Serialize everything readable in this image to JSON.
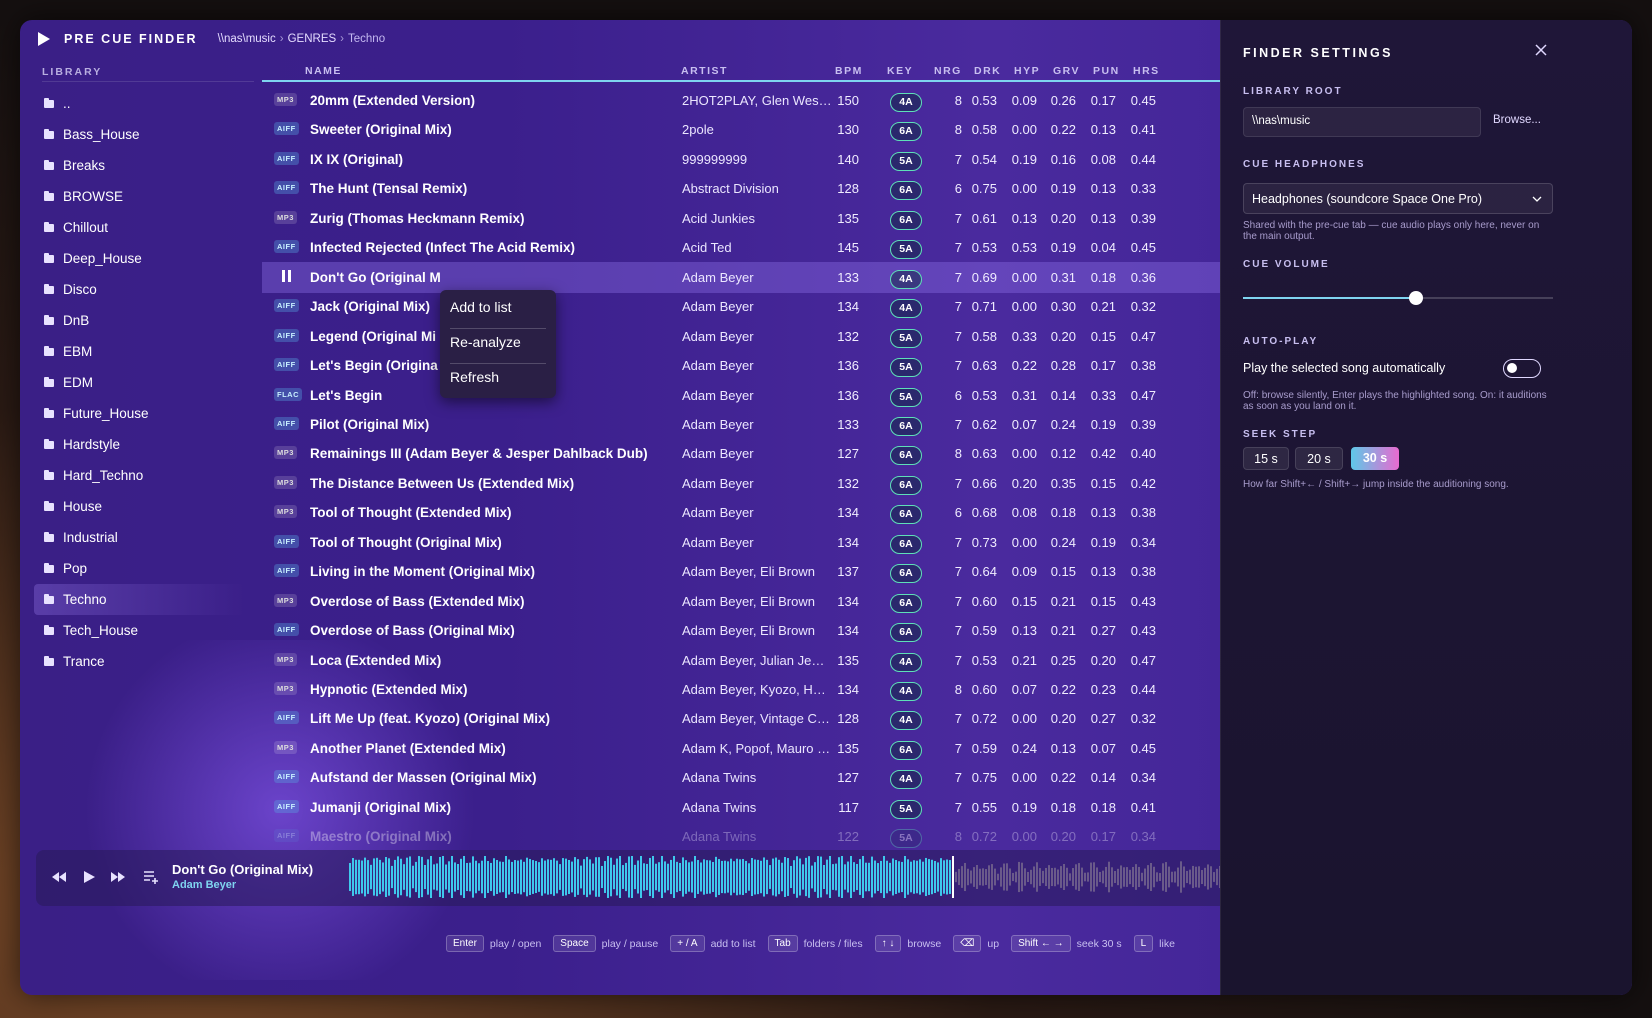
{
  "app": {
    "title": "PRE CUE FINDER"
  },
  "breadcrumb": [
    "\\\\nas\\music",
    "GENRES",
    "Techno"
  ],
  "library": {
    "heading": "LIBRARY",
    "folders": [
      "..",
      "Bass_House",
      "Breaks",
      "BROWSE",
      "Chillout",
      "Deep_House",
      "Disco",
      "DnB",
      "EBM",
      "EDM",
      "Future_House",
      "Hardstyle",
      "Hard_Techno",
      "House",
      "Industrial",
      "Pop",
      "Techno",
      "Tech_House",
      "Trance"
    ],
    "active": "Techno"
  },
  "columns": {
    "name": "NAME",
    "artist": "ARTIST",
    "bpm": "BPM",
    "key": "KEY",
    "nrg": "NRG",
    "drk": "DRK",
    "hyp": "HYP",
    "grv": "GRV",
    "pun": "PUN",
    "hrs": "HRS"
  },
  "tracks": [
    {
      "fmt": "MP3",
      "name": "20mm (Extended Version)",
      "artist": "2HOT2PLAY, Glen West ...",
      "bpm": "150",
      "key": "4A",
      "nrg": "8",
      "drk": "0.53",
      "hyp": "0.09",
      "grv": "0.26",
      "pun": "0.17",
      "hrs": "0.45"
    },
    {
      "fmt": "AIFF",
      "name": "Sweeter (Original Mix)",
      "artist": "2pole",
      "bpm": "130",
      "key": "6A",
      "nrg": "8",
      "drk": "0.58",
      "hyp": "0.00",
      "grv": "0.22",
      "pun": "0.13",
      "hrs": "0.41"
    },
    {
      "fmt": "AIFF",
      "name": "IX IX (Original)",
      "artist": "999999999",
      "bpm": "140",
      "key": "5A",
      "nrg": "7",
      "drk": "0.54",
      "hyp": "0.19",
      "grv": "0.16",
      "pun": "0.08",
      "hrs": "0.44"
    },
    {
      "fmt": "AIFF",
      "name": "The Hunt (Tensal Remix)",
      "artist": "Abstract Division",
      "bpm": "128",
      "key": "6A",
      "nrg": "6",
      "drk": "0.75",
      "hyp": "0.00",
      "grv": "0.19",
      "pun": "0.13",
      "hrs": "0.33"
    },
    {
      "fmt": "MP3",
      "name": "Zurig (Thomas Heckmann Remix)",
      "artist": "Acid Junkies",
      "bpm": "135",
      "key": "6A",
      "nrg": "7",
      "drk": "0.61",
      "hyp": "0.13",
      "grv": "0.20",
      "pun": "0.13",
      "hrs": "0.39"
    },
    {
      "fmt": "AIFF",
      "name": "Infected Rejected (Infect The Acid Remix)",
      "artist": "Acid Ted",
      "bpm": "145",
      "key": "5A",
      "nrg": "7",
      "drk": "0.53",
      "hyp": "0.53",
      "grv": "0.19",
      "pun": "0.04",
      "hrs": "0.45"
    },
    {
      "fmt": "",
      "name": "Don't Go (Original M",
      "artist": "Adam Beyer",
      "bpm": "133",
      "key": "4A",
      "nrg": "7",
      "drk": "0.69",
      "hyp": "0.00",
      "grv": "0.31",
      "pun": "0.18",
      "hrs": "0.36",
      "playing": true
    },
    {
      "fmt": "AIFF",
      "name": "Jack (Original Mix)",
      "artist": "Adam Beyer",
      "bpm": "134",
      "key": "4A",
      "nrg": "7",
      "drk": "0.71",
      "hyp": "0.00",
      "grv": "0.30",
      "pun": "0.21",
      "hrs": "0.32"
    },
    {
      "fmt": "AIFF",
      "name": "Legend (Original Mi",
      "artist": "Adam Beyer",
      "bpm": "132",
      "key": "5A",
      "nrg": "7",
      "drk": "0.58",
      "hyp": "0.33",
      "grv": "0.20",
      "pun": "0.15",
      "hrs": "0.47"
    },
    {
      "fmt": "AIFF",
      "name": "Let's Begin (Origina",
      "artist": "Adam Beyer",
      "bpm": "136",
      "key": "5A",
      "nrg": "7",
      "drk": "0.63",
      "hyp": "0.22",
      "grv": "0.28",
      "pun": "0.17",
      "hrs": "0.38"
    },
    {
      "fmt": "FLAC",
      "name": "Let's Begin",
      "artist": "Adam Beyer",
      "bpm": "136",
      "key": "5A",
      "nrg": "6",
      "drk": "0.53",
      "hyp": "0.31",
      "grv": "0.14",
      "pun": "0.33",
      "hrs": "0.47"
    },
    {
      "fmt": "AIFF",
      "name": "Pilot (Original Mix)",
      "artist": "Adam Beyer",
      "bpm": "133",
      "key": "6A",
      "nrg": "7",
      "drk": "0.62",
      "hyp": "0.07",
      "grv": "0.24",
      "pun": "0.19",
      "hrs": "0.39"
    },
    {
      "fmt": "MP3",
      "name": "Remainings III (Adam Beyer & Jesper Dahlback Dub)",
      "artist": "Adam Beyer",
      "bpm": "127",
      "key": "6A",
      "nrg": "8",
      "drk": "0.63",
      "hyp": "0.00",
      "grv": "0.12",
      "pun": "0.42",
      "hrs": "0.40"
    },
    {
      "fmt": "MP3",
      "name": "The Distance Between Us (Extended Mix)",
      "artist": "Adam Beyer",
      "bpm": "132",
      "key": "6A",
      "nrg": "7",
      "drk": "0.66",
      "hyp": "0.20",
      "grv": "0.35",
      "pun": "0.15",
      "hrs": "0.42"
    },
    {
      "fmt": "MP3",
      "name": "Tool of Thought (Extended Mix)",
      "artist": "Adam Beyer",
      "bpm": "134",
      "key": "6A",
      "nrg": "6",
      "drk": "0.68",
      "hyp": "0.08",
      "grv": "0.18",
      "pun": "0.13",
      "hrs": "0.38"
    },
    {
      "fmt": "AIFF",
      "name": "Tool of Thought (Original Mix)",
      "artist": "Adam Beyer",
      "bpm": "134",
      "key": "6A",
      "nrg": "7",
      "drk": "0.73",
      "hyp": "0.00",
      "grv": "0.24",
      "pun": "0.19",
      "hrs": "0.34"
    },
    {
      "fmt": "AIFF",
      "name": "Living in the Moment (Original Mix)",
      "artist": "Adam Beyer, Eli Brown",
      "bpm": "137",
      "key": "6A",
      "nrg": "7",
      "drk": "0.64",
      "hyp": "0.09",
      "grv": "0.15",
      "pun": "0.13",
      "hrs": "0.38"
    },
    {
      "fmt": "MP3",
      "name": "Overdose of Bass (Extended Mix)",
      "artist": "Adam Beyer, Eli Brown",
      "bpm": "134",
      "key": "6A",
      "nrg": "7",
      "drk": "0.60",
      "hyp": "0.15",
      "grv": "0.21",
      "pun": "0.15",
      "hrs": "0.43"
    },
    {
      "fmt": "AIFF",
      "name": "Overdose of Bass (Original Mix)",
      "artist": "Adam Beyer, Eli Brown",
      "bpm": "134",
      "key": "6A",
      "nrg": "7",
      "drk": "0.59",
      "hyp": "0.13",
      "grv": "0.21",
      "pun": "0.27",
      "hrs": "0.43"
    },
    {
      "fmt": "MP3",
      "name": "Loca (Extended Mix)",
      "artist": "Adam Beyer, Julian Jeweil",
      "bpm": "135",
      "key": "4A",
      "nrg": "7",
      "drk": "0.53",
      "hyp": "0.21",
      "grv": "0.25",
      "pun": "0.20",
      "hrs": "0.47"
    },
    {
      "fmt": "MP3",
      "name": "Hypnotic (Extended Mix)",
      "artist": "Adam Beyer, Kyozo, HNTR",
      "bpm": "134",
      "key": "4A",
      "nrg": "8",
      "drk": "0.60",
      "hyp": "0.07",
      "grv": "0.22",
      "pun": "0.23",
      "hrs": "0.44"
    },
    {
      "fmt": "AIFF",
      "name": "Lift Me Up (feat. Kyozo) (Original Mix)",
      "artist": "Adam Beyer, Vintage Cul...",
      "bpm": "128",
      "key": "4A",
      "nrg": "7",
      "drk": "0.72",
      "hyp": "0.00",
      "grv": "0.20",
      "pun": "0.27",
      "hrs": "0.32"
    },
    {
      "fmt": "MP3",
      "name": "Another Planet (Extended Mix)",
      "artist": "Adam K, Popof, Mauro S...",
      "bpm": "135",
      "key": "6A",
      "nrg": "7",
      "drk": "0.59",
      "hyp": "0.24",
      "grv": "0.13",
      "pun": "0.07",
      "hrs": "0.45"
    },
    {
      "fmt": "AIFF",
      "name": "Aufstand der Massen (Original Mix)",
      "artist": "Adana Twins",
      "bpm": "127",
      "key": "4A",
      "nrg": "7",
      "drk": "0.75",
      "hyp": "0.00",
      "grv": "0.22",
      "pun": "0.14",
      "hrs": "0.34"
    },
    {
      "fmt": "AIFF",
      "name": "Jumanji (Original Mix)",
      "artist": "Adana Twins",
      "bpm": "117",
      "key": "5A",
      "nrg": "7",
      "drk": "0.55",
      "hyp": "0.19",
      "grv": "0.18",
      "pun": "0.18",
      "hrs": "0.41"
    },
    {
      "fmt": "AIFF",
      "name": "Maestro (Original Mix)",
      "artist": "Adana Twins",
      "bpm": "122",
      "key": "5A",
      "nrg": "8",
      "drk": "0.72",
      "hyp": "0.00",
      "grv": "0.20",
      "pun": "0.17",
      "hrs": "0.34"
    }
  ],
  "context_menu": [
    "Add to list",
    "Re-analyze",
    "Refresh"
  ],
  "player": {
    "title": "Don't Go (Original Mix)",
    "artist": "Adam Beyer",
    "progress": 0.67
  },
  "hints": [
    [
      "Enter",
      "play / open"
    ],
    [
      "Space",
      "play / pause"
    ],
    [
      "+ / A",
      "add to list"
    ],
    [
      "Tab",
      "folders / files"
    ],
    [
      "↑ ↓",
      "browse"
    ],
    [
      "⌫",
      "up"
    ],
    [
      "Shift ← →",
      "seek 30 s"
    ],
    [
      "L",
      "like"
    ]
  ],
  "settings": {
    "title": "FINDER SETTINGS",
    "library_root_label": "LIBRARY ROOT",
    "library_root_value": "\\\\nas\\music",
    "browse": "Browse...",
    "headphones_label": "CUE HEADPHONES",
    "headphones_value": "Headphones (soundcore Space One Pro)",
    "headphones_note": "Shared with the pre-cue tab — cue audio plays only here, never on the main output.",
    "volume_label": "CUE VOLUME",
    "volume": 0.56,
    "autoplay_label": "AUTO-PLAY",
    "autoplay_text": "Play the selected song automatically",
    "autoplay_on": false,
    "autoplay_note": "Off: browse silently, Enter plays the highlighted song. On: it auditions as soon as you land on it.",
    "seek_label": "SEEK STEP",
    "seek_options": [
      "15 s",
      "20 s",
      "30 s"
    ],
    "seek_selected": "30 s",
    "seek_note": "How far Shift+← / Shift+→ jump inside the auditioning song."
  },
  "colors": {
    "accent": "#7fd4f0",
    "key_border": "#5ee0b8",
    "seek_gradient_start": "#5ec8e8",
    "seek_gradient_end": "#e86ad0"
  }
}
